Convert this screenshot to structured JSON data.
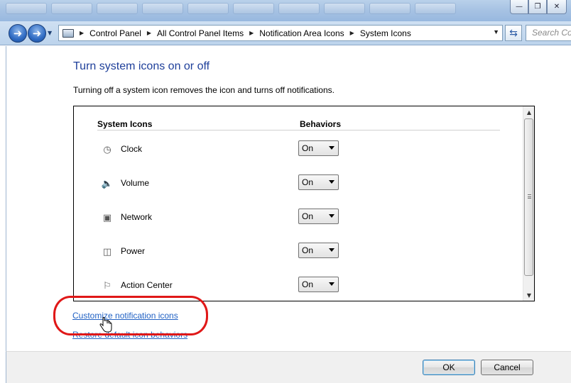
{
  "window": {
    "minimize_glyph": "—",
    "maximize_glyph": "❐",
    "close_glyph": "✕"
  },
  "nav": {
    "back_icon": "back-arrow-icon",
    "forward_icon": "forward-arrow-icon",
    "breadcrumbs": [
      "Control Panel",
      "All Control Panel Items",
      "Notification Area Icons",
      "System Icons"
    ],
    "search_placeholder": "Search Co"
  },
  "main": {
    "title": "Turn system icons on or off",
    "description": "Turning off a system icon removes the icon and turns off notifications.",
    "columns": [
      "System Icons",
      "Behaviors"
    ],
    "rows": [
      {
        "name": "Clock",
        "behavior": "On",
        "icon": "clock-icon"
      },
      {
        "name": "Volume",
        "behavior": "On",
        "icon": "volume-icon"
      },
      {
        "name": "Network",
        "behavior": "On",
        "icon": "network-icon"
      },
      {
        "name": "Power",
        "behavior": "On",
        "icon": "power-icon"
      },
      {
        "name": "Action Center",
        "behavior": "On",
        "icon": "action-center-flag-icon"
      }
    ],
    "links": {
      "customize": "Customize notification icons",
      "restore": "Restore default icon behaviors"
    }
  },
  "buttons": {
    "ok": "OK",
    "cancel": "Cancel"
  },
  "colors": {
    "title_blue": "#1e3f9a",
    "link_blue": "#2262c4",
    "highlight_red": "#e01818"
  }
}
